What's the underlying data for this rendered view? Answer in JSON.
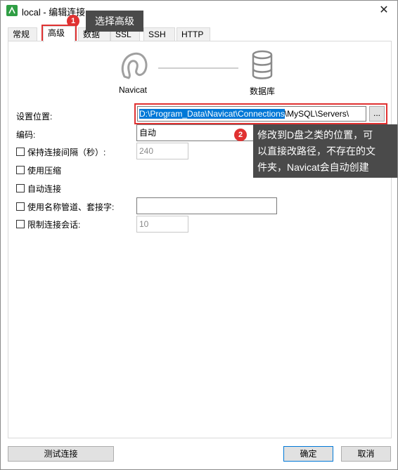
{
  "window": {
    "title": "local - 编辑连接",
    "close_symbol": "✕"
  },
  "tabs": [
    {
      "label": "常规"
    },
    {
      "label": "高级"
    },
    {
      "label": "数据库"
    },
    {
      "label": "SSL"
    },
    {
      "label": "SSH"
    },
    {
      "label": "HTTP"
    }
  ],
  "active_tab": "高级",
  "diagram": {
    "left_label": "Navicat",
    "right_label": "数据库"
  },
  "settings": {
    "location_label": "设置位置:",
    "location_selected": "D:\\Program_Data\\Navicat\\Connections",
    "location_rest": "\\MySQL\\Servers\\",
    "browse_label": "...",
    "encoding_label": "编码:",
    "encoding_value": "自动",
    "keepalive_label": "保持连接间隔（秒）:",
    "keepalive_value": "240",
    "keepalive_checked": false,
    "compress_label": "使用压缩",
    "compress_checked": false,
    "autoconnect_label": "自动连接",
    "autoconnect_checked": false,
    "pipe_label": "使用名称管道、套接字:",
    "pipe_value": "",
    "pipe_checked": false,
    "limit_label": "限制连接会话:",
    "limit_value": "10",
    "limit_checked": false
  },
  "annotations": {
    "step1_number": "1",
    "step1_text": "选择高级",
    "step2_number": "2",
    "step2_line1": "修改到D盘之类的位置，可",
    "step2_line2": "以直接改路径，不存在的文",
    "step2_line3": "件夹，Navicat会自动创建"
  },
  "buttons": {
    "test": "测试连接",
    "ok": "确定",
    "cancel": "取消"
  },
  "colors": {
    "accent": "#0078d7",
    "highlight": "#e03131",
    "callout_bg": "#4a4a4a",
    "app_icon": "#2f9e44"
  }
}
